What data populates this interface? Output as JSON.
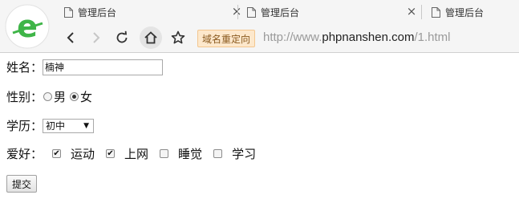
{
  "browser": {
    "tabs": [
      {
        "title": "管理后台"
      },
      {
        "title": "管理后台"
      },
      {
        "title": "管理后台"
      }
    ],
    "redirect_badge": "域名重定向",
    "url_prefix": "http://www.",
    "url_host": "phpnanshen.com",
    "url_path": "/1.html",
    "logo_letter": "e"
  },
  "form": {
    "name_label": "姓名：",
    "name_value": "楠神",
    "gender_label": "性别：",
    "gender_options": [
      {
        "label": "男",
        "checked": false
      },
      {
        "label": "女",
        "checked": true
      }
    ],
    "education_label": "学历：",
    "education_selected": "初中",
    "hobby_label": "爱好：",
    "hobbies": [
      {
        "label": "运动",
        "checked": true
      },
      {
        "label": "上网",
        "checked": true
      },
      {
        "label": "睡觉",
        "checked": false
      },
      {
        "label": "学习",
        "checked": false
      }
    ],
    "submit_label": "提交"
  },
  "colors": {
    "logo_green": "#3fb548",
    "redirect_bg": "#fde8cc"
  }
}
